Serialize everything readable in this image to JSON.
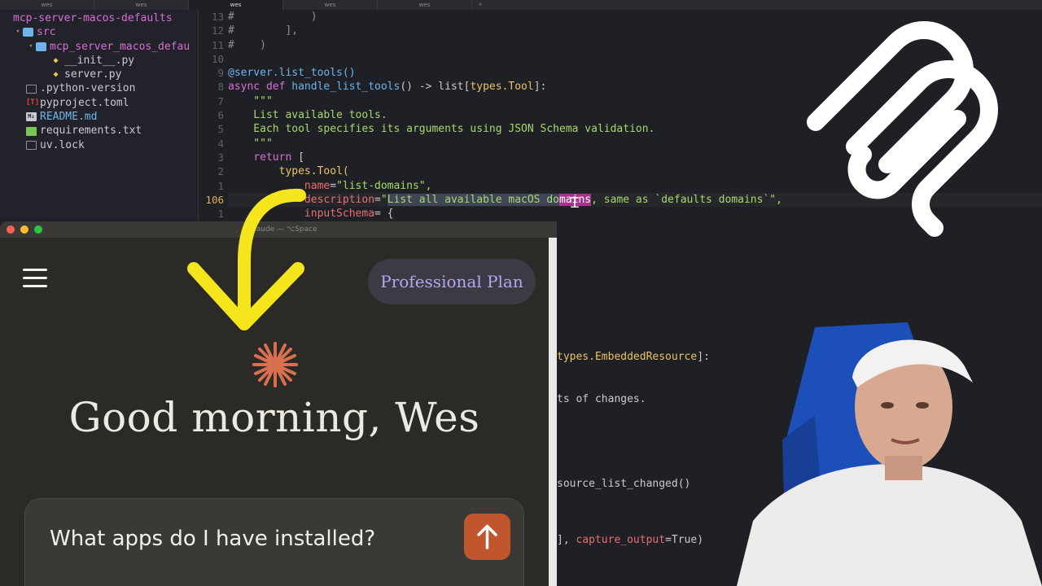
{
  "editor": {
    "tabs": [
      "wes",
      "wes",
      "wes",
      "wes",
      "wes"
    ],
    "active_tab_index": 2,
    "filetree": [
      {
        "label": "mcp-server-macos-defaults",
        "kind": "root"
      },
      {
        "label": "src",
        "kind": "folder"
      },
      {
        "label": "mcp_server_macos_defau",
        "kind": "folder"
      },
      {
        "label": "__init__.py",
        "kind": "py"
      },
      {
        "label": "server.py",
        "kind": "py"
      },
      {
        "label": ".python-version",
        "kind": "file"
      },
      {
        "label": "pyproject.toml",
        "kind": "toml"
      },
      {
        "label": "README.md",
        "kind": "md"
      },
      {
        "label": "requirements.txt",
        "kind": "txt"
      },
      {
        "label": "uv.lock",
        "kind": "lock"
      }
    ],
    "line_numbers": [
      "13",
      "12",
      "11",
      "10",
      "9",
      "8",
      "7",
      "6",
      "5",
      "4",
      "3",
      "2",
      "1",
      "106",
      "1"
    ],
    "code": {
      "l13": "#            )",
      "l12": "#        ],",
      "l11": "#    )",
      "l9_decorator": "@server.list_tools()",
      "l8_async": "async",
      "l8_def": "def",
      "l8_name": "handle_list_tools",
      "l8_rest": "() -> list[",
      "l8_type": "types.Tool",
      "l8_end": "]:",
      "l7": "    \"\"\"",
      "l6": "    List available tools.",
      "l5": "    Each tool specifies its arguments using JSON Schema validation.",
      "l4": "    \"\"\"",
      "l3_return": "return",
      "l3_rest": " [",
      "l2_types": "types.Tool(",
      "l1_param": "name",
      "l1_eq": "=",
      "l1_str": "\"list-domains\",",
      "l106_param": "description",
      "l106_eq": "=",
      "l106_q": "\"",
      "l106_sel": "List all available macOS do",
      "l106_hl": "mains",
      "l106_rest": ", same as `defaults domains`\",",
      "l0_param": "inputSchema",
      "l0_rest": "= {"
    },
    "right_code": {
      "r1_type": "types.EmbeddedResource",
      "r1_end": "]:",
      "r2": "ts of changes.",
      "r3": "source_list_changed()",
      "r4_pre": "], ",
      "r4_param": "capture_output",
      "r4_val": "=True)"
    }
  },
  "claude": {
    "window_title": "Claude — ⌥Space",
    "plan_badge": "Professional Plan",
    "greeting": "Good morning, Wes",
    "prompt": "What apps do I have installed?"
  },
  "colors": {
    "accent_send": "#c1562e",
    "plan_text": "#b9a4f0",
    "annotation_arrow": "#f5e51c",
    "spark": "#d8704f"
  }
}
